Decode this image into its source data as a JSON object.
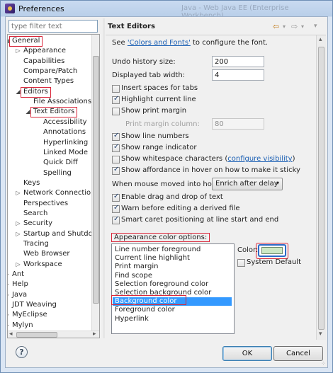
{
  "window": {
    "title": "Preferences",
    "title_ghost": "Java - Web Java EE (Enterprise Workbench)"
  },
  "filter": {
    "placeholder": "type filter text"
  },
  "tree": {
    "items": [
      {
        "label": "General",
        "twisty": "expanded"
      },
      {
        "label": "Appearance",
        "twisty": "collapsed"
      },
      {
        "label": "Capabilities",
        "twisty": ""
      },
      {
        "label": "Compare/Patch",
        "twisty": ""
      },
      {
        "label": "Content Types",
        "twisty": ""
      },
      {
        "label": "Editors",
        "twisty": "expanded"
      },
      {
        "label": "File Associations",
        "twisty": ""
      },
      {
        "label": "Text Editors",
        "twisty": "expanded"
      },
      {
        "label": "Accessibility",
        "twisty": ""
      },
      {
        "label": "Annotations",
        "twisty": ""
      },
      {
        "label": "Hyperlinking",
        "twisty": ""
      },
      {
        "label": "Linked Mode",
        "twisty": ""
      },
      {
        "label": "Quick Diff",
        "twisty": ""
      },
      {
        "label": "Spelling",
        "twisty": ""
      },
      {
        "label": "Keys",
        "twisty": ""
      },
      {
        "label": "Network Connections",
        "twisty": "collapsed"
      },
      {
        "label": "Perspectives",
        "twisty": ""
      },
      {
        "label": "Search",
        "twisty": ""
      },
      {
        "label": "Security",
        "twisty": "collapsed"
      },
      {
        "label": "Startup and Shutdown",
        "twisty": "collapsed"
      },
      {
        "label": "Tracing",
        "twisty": ""
      },
      {
        "label": "Web Browser",
        "twisty": ""
      },
      {
        "label": "Workspace",
        "twisty": "collapsed"
      },
      {
        "label": "Ant",
        "twisty": "collapsed"
      },
      {
        "label": "Help",
        "twisty": "collapsed"
      },
      {
        "label": "Java",
        "twisty": "collapsed"
      },
      {
        "label": "JDT Weaving",
        "twisty": ""
      },
      {
        "label": "MyEclipse",
        "twisty": "collapsed"
      },
      {
        "label": "Mylyn",
        "twisty": "collapsed"
      }
    ],
    "twisty_glyphs": {
      "expanded": "◢",
      "collapsed": "▷"
    }
  },
  "page": {
    "title": "Text Editors",
    "nav_back": "⇦",
    "nav_back_menu": "▾",
    "nav_forward": "⇨",
    "nav_forward_menu": "▾",
    "nav_menu": "▾",
    "intro_prefix": "See ",
    "intro_link": "'Colors and Fonts'",
    "intro_suffix": " to configure the font.",
    "undo_label": "Undo history size:",
    "undo_value": "200",
    "tab_label": "Displayed tab width:",
    "tab_value": "4",
    "cb_insert_spaces": "Insert spaces for tabs",
    "cb_highlight_line": "Highlight current line",
    "cb_print_margin": "Show print margin",
    "margin_label": "Print margin column:",
    "margin_value": "80",
    "cb_line_numbers": "Show line numbers",
    "cb_range_indicator": "Show range indicator",
    "cb_whitespace_prefix": "Show whitespace characters (",
    "cb_whitespace_link": "configure visibility",
    "cb_whitespace_suffix": ")",
    "cb_affordance": "Show affordance in hover on how to make it sticky",
    "hover_label": "When mouse moved into hover:",
    "hover_value": "Enrich after delay",
    "cb_drag_drop": "Enable drag and drop of text",
    "cb_warn_derived": "Warn before editing a derived file",
    "cb_smart_caret": "Smart caret positioning at line start and end",
    "appearance_label": "Appearance color options:",
    "color_options": [
      "Line number foreground",
      "Current line highlight",
      "Print margin",
      "Find scope",
      "Selection foreground color",
      "Selection background color",
      "Background color",
      "Foreground color",
      "Hyperlink"
    ],
    "selected_option": "Background color",
    "color_label": "Color:",
    "color_value": "#cde8c5",
    "system_default": "System Default"
  },
  "checkbox_state": {
    "insert_spaces": false,
    "highlight_line": true,
    "print_margin": false,
    "line_numbers": true,
    "range_indicator": true,
    "whitespace": false,
    "affordance": true,
    "drag_drop": true,
    "warn_derived": true,
    "smart_caret": true,
    "system_default": false
  },
  "buttons": {
    "help": "?",
    "ok": "OK",
    "cancel": "Cancel"
  },
  "scroll_arrows": {
    "up": "▴",
    "down": "▾",
    "left": "◂",
    "right": "▸"
  },
  "grip": "⁘"
}
